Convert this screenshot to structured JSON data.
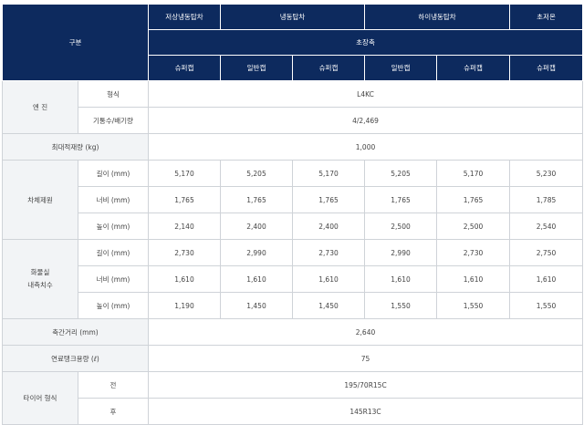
{
  "header": {
    "category": "구분",
    "top": [
      "저상냉동탑차",
      "냉동탑차",
      "하이냉동탑차",
      "초저온"
    ],
    "mid": "초장축",
    "trims": [
      "슈퍼캡",
      "일반캡",
      "슈퍼캡",
      "일반캡",
      "슈퍼캡",
      "슈퍼캡"
    ]
  },
  "engine": {
    "group": "엔 진",
    "type_label": "형식",
    "type_value": "L4KC",
    "cyl_label": "기통수/배기량",
    "cyl_value": "4/2,469"
  },
  "max_load": {
    "label": "최대적재량 (kg)",
    "value": "1,000"
  },
  "body": {
    "group": "차체제원",
    "rows": [
      {
        "label": "길이 (mm)",
        "values": [
          "5,170",
          "5,205",
          "5,170",
          "5,205",
          "5,170",
          "5,230"
        ]
      },
      {
        "label": "너비 (mm)",
        "values": [
          "1,765",
          "1,765",
          "1,765",
          "1,765",
          "1,765",
          "1,785"
        ]
      },
      {
        "label": "높이 (mm)",
        "values": [
          "2,140",
          "2,400",
          "2,400",
          "2,500",
          "2,500",
          "2,540"
        ]
      }
    ]
  },
  "cargo": {
    "group_line1": "화물실",
    "group_line2": "내측치수",
    "rows": [
      {
        "label": "길이 (mm)",
        "values": [
          "2,730",
          "2,990",
          "2,730",
          "2,990",
          "2,730",
          "2,750"
        ]
      },
      {
        "label": "너비 (mm)",
        "values": [
          "1,610",
          "1,610",
          "1,610",
          "1,610",
          "1,610",
          "1,610"
        ]
      },
      {
        "label": "높이 (mm)",
        "values": [
          "1,190",
          "1,450",
          "1,450",
          "1,550",
          "1,550",
          "1,550"
        ]
      }
    ]
  },
  "wheelbase": {
    "label": "축간거리 (mm)",
    "value": "2,640"
  },
  "fuel_tank": {
    "label": "연료탱크용량 (ℓ)",
    "value": "75"
  },
  "tire": {
    "group": "타이어 형식",
    "front_label": "전",
    "front_value": "195/70R15C",
    "rear_label": "후",
    "rear_value": "145R13C"
  }
}
